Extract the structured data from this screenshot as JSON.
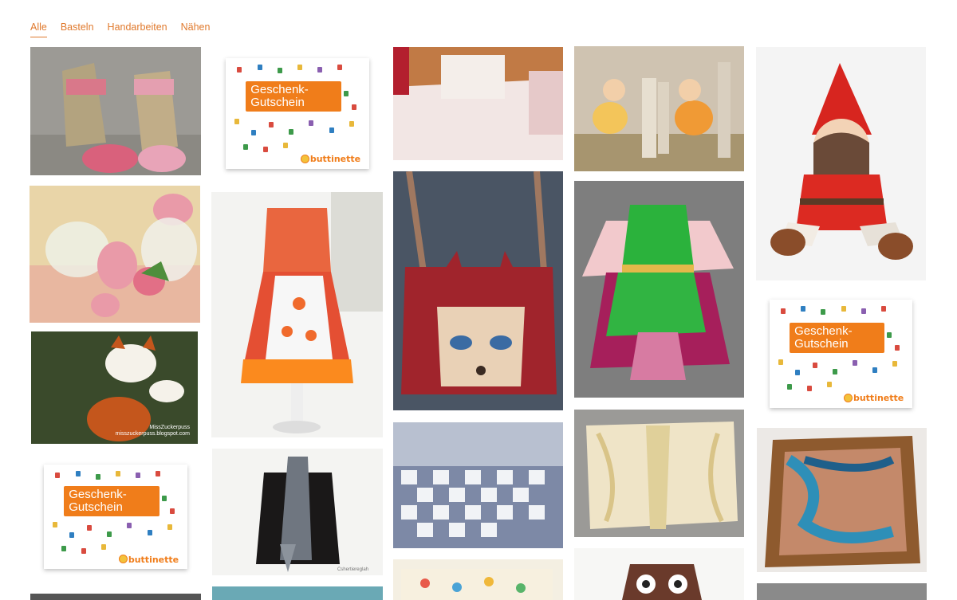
{
  "filters": [
    {
      "label": "Alle",
      "active": true
    },
    {
      "label": "Basteln",
      "active": false
    },
    {
      "label": "Handarbeiten",
      "active": false
    },
    {
      "label": "Nähen",
      "active": false
    }
  ],
  "voucher": {
    "line1": "Geschenk-",
    "line2": "Gutschein",
    "brand": "buttinette"
  },
  "photo_captions": {
    "fox_watermark_line1": "MissZuckerpuss",
    "fox_watermark_line2": "misszuckerpuss.blogspot.com",
    "scarf_watermark": "Cshertiereglah"
  },
  "colors": {
    "accent": "#e07a2e",
    "voucher_orange": "#f07d1a"
  }
}
